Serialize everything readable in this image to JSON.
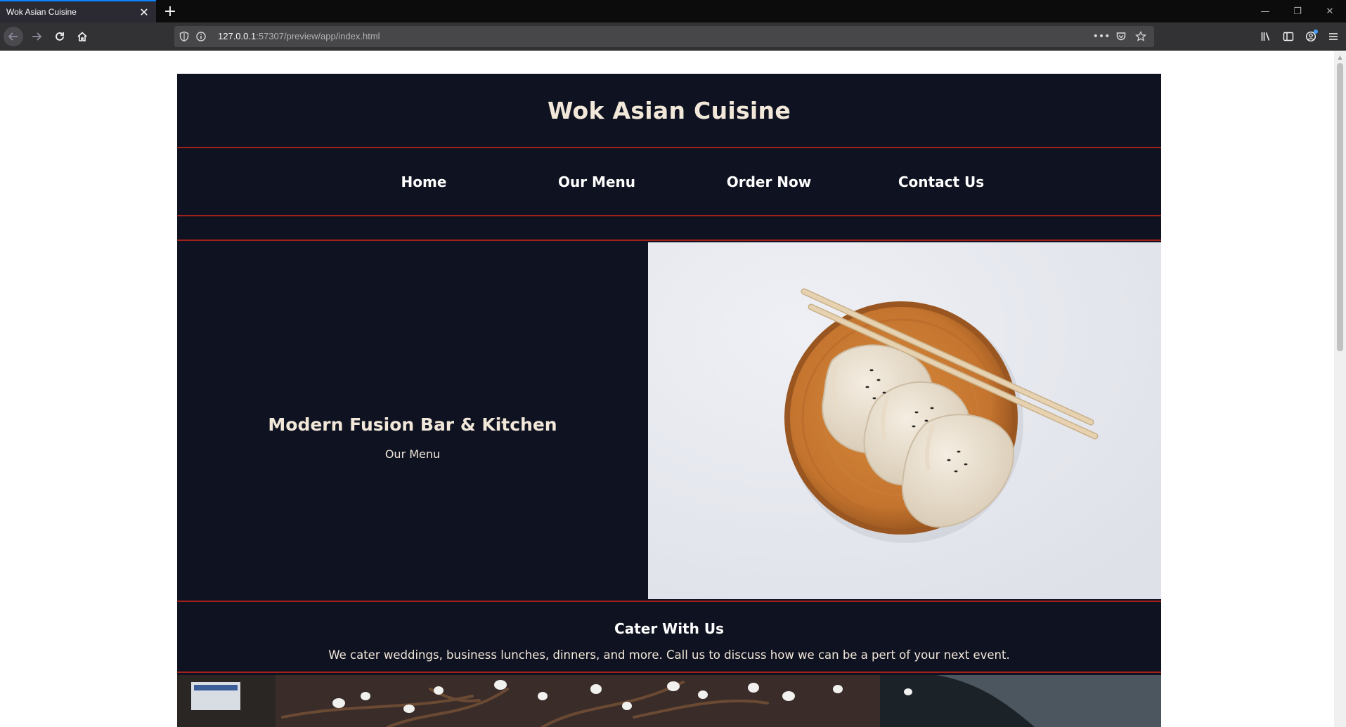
{
  "browser": {
    "tab_title": "Wok Asian Cuisine",
    "tab_close": "✕",
    "new_tab": "+",
    "window": {
      "minimize": "—",
      "restore": "❐",
      "close": "✕"
    },
    "url_host": "127.0.0.1",
    "url_rest": ":57307/preview/app/index.html",
    "url_actions": {
      "more": "•••"
    }
  },
  "site": {
    "title": "Wok Asian Cuisine",
    "nav": [
      {
        "label": "Home"
      },
      {
        "label": "Our Menu"
      },
      {
        "label": "Order Now"
      },
      {
        "label": "Contact Us"
      }
    ],
    "hero": {
      "title": "Modern Fusion Bar & Kitchen",
      "subtitle": "Our Menu",
      "image": "dumplings-on-wooden-plate-with-chopsticks"
    },
    "cater": {
      "title": "Cater With Us",
      "text": "We cater weddings, business lunches, dinners, and more. Call us to discuss how we can be a pert of your next event."
    },
    "bottom_image": "dark-table-with-branches-and-bowls"
  },
  "colors": {
    "page_bg": "#0f1220",
    "accent_rule": "#a0211b",
    "title_text": "#f2e8da",
    "nav_text": "#ffffff",
    "hero_image_bg": "#e8eaf0",
    "wood": "#c87a33"
  }
}
